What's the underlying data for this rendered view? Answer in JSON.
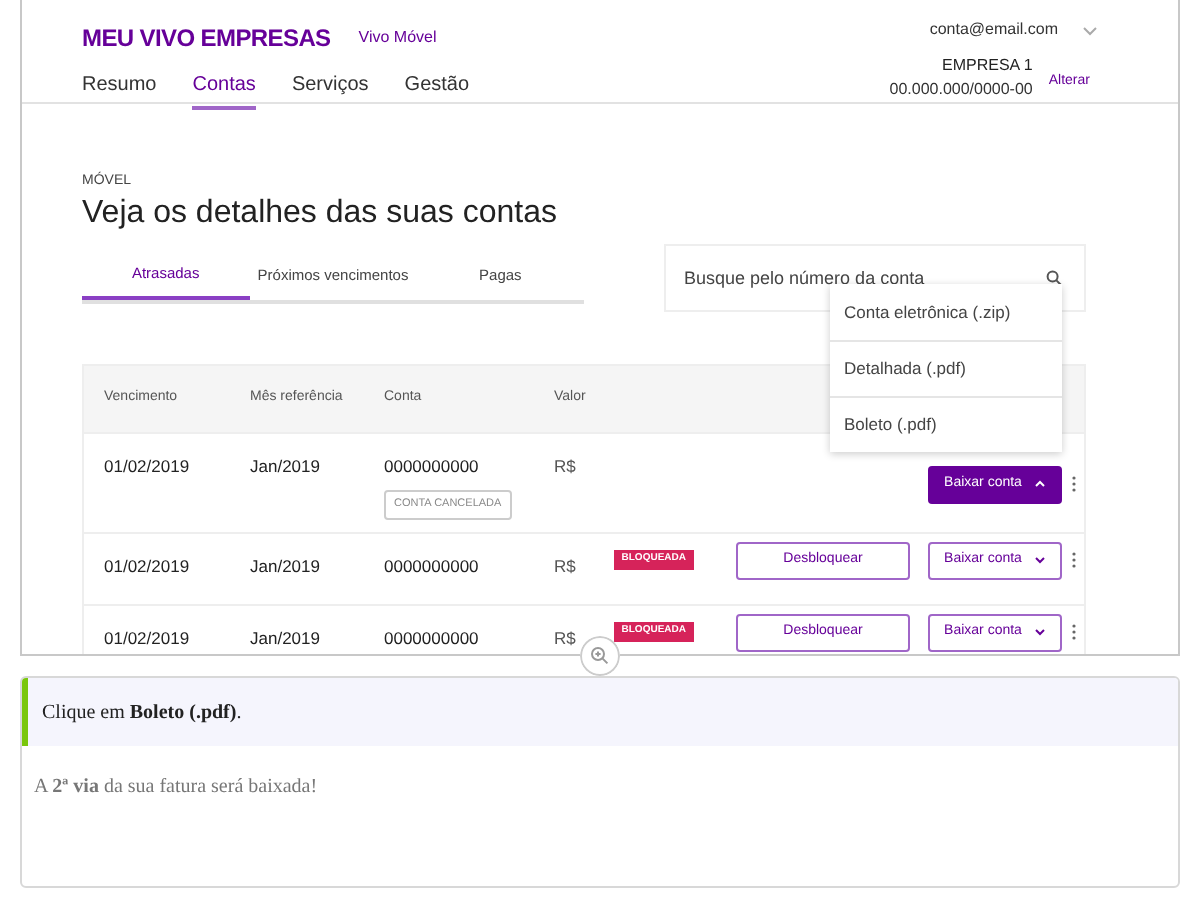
{
  "header": {
    "logo": "MEU VIVO EMPRESAS",
    "product": "Vivo Móvel",
    "nav": [
      {
        "label": "Resumo",
        "selected": false
      },
      {
        "label": "Contas",
        "selected": true
      },
      {
        "label": "Serviços",
        "selected": false
      },
      {
        "label": "Gestão",
        "selected": false
      }
    ],
    "account": {
      "email": "conta@email.com",
      "company": "EMPRESA 1",
      "cnpj": "00.000.000/0000-00",
      "change_link": "Alterar"
    }
  },
  "page": {
    "eyebrow": "MÓVEL",
    "title": "Veja os detalhes das suas contas",
    "tabs": [
      {
        "label": "Atrasadas",
        "selected": true
      },
      {
        "label": "Próximos vencimentos",
        "selected": false
      },
      {
        "label": "Pagas",
        "selected": false
      }
    ],
    "search": {
      "placeholder": "Busque pelo número da conta"
    }
  },
  "table": {
    "columns": [
      "Vencimento",
      "Mês referência",
      "Conta",
      "Valor"
    ],
    "rows": [
      {
        "due": "01/02/2019",
        "month": "Jan/2019",
        "account": "0000000000",
        "value": "R$",
        "tag": "CONTA CANCELADA",
        "download": {
          "label": "Baixar conta",
          "expanded": true,
          "menu": [
            "Conta eletrônica (.zip)",
            "Detalhada (.pdf)",
            "Boleto (.pdf)"
          ]
        }
      },
      {
        "due": "01/02/2019",
        "month": "Jan/2019",
        "account": "0000000000",
        "value": "R$",
        "badge": "BLOQUEADA",
        "unlock": "Desbloquear",
        "download": {
          "label": "Baixar conta",
          "expanded": false
        }
      },
      {
        "due": "01/02/2019",
        "month": "Jan/2019",
        "account": "0000000000",
        "value": "R$",
        "badge": "BLOQUEADA",
        "unlock": "Desbloquear",
        "download": {
          "label": "Baixar conta",
          "expanded": false
        }
      }
    ]
  },
  "instruction": {
    "step": "Clique em **Boleto (.pdf)**.",
    "note": "A **2ª via** da sua fatura será baixada!"
  }
}
